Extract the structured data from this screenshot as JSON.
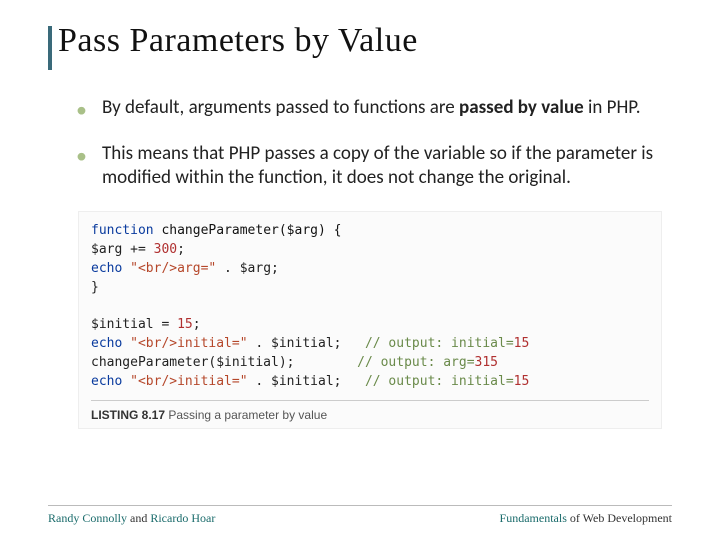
{
  "title": "Pass Parameters by Value",
  "bullets": {
    "b1a": "By default, arguments passed to functions are ",
    "b1b": "passed by value",
    "b1c": " in PHP.",
    "b2": "This means that PHP passes a copy of the variable so if the parameter is modified within the function, it does not change the original."
  },
  "code": {
    "l1a": "function",
    "l1b": " changeParameter($arg) {",
    "l2a": "   $arg += ",
    "l2b": "300",
    "l2c": ";",
    "l3a": "   ",
    "l3b": "echo",
    "l3c": " ",
    "l3d": "\"<br/>arg=\"",
    "l3e": " . $arg;",
    "l4": "}",
    "l6a": "$initial = ",
    "l6b": "15",
    "l6c": ";",
    "l7a": "echo",
    "l7b": " ",
    "l7c": "\"<br/>initial=\"",
    "l7d": " . $initial;",
    "c7a": "// output: initial=",
    "c7b": "15",
    "l8": "changeParameter($initial);",
    "c8a": "// output: arg=",
    "c8b": "315",
    "l9a": "echo",
    "l9b": " ",
    "l9c": "\"<br/>initial=\"",
    "l9d": " . $initial;",
    "c9a": "// output: initial=",
    "c9b": "15"
  },
  "listing": {
    "num": "LISTING 8.17",
    "caption": " Passing a parameter by value"
  },
  "footer": {
    "a1": "Randy Connolly",
    "a2": " and ",
    "a3": "Ricardo Hoar",
    "b1": "Fundamentals",
    "b2": " of Web Development"
  }
}
